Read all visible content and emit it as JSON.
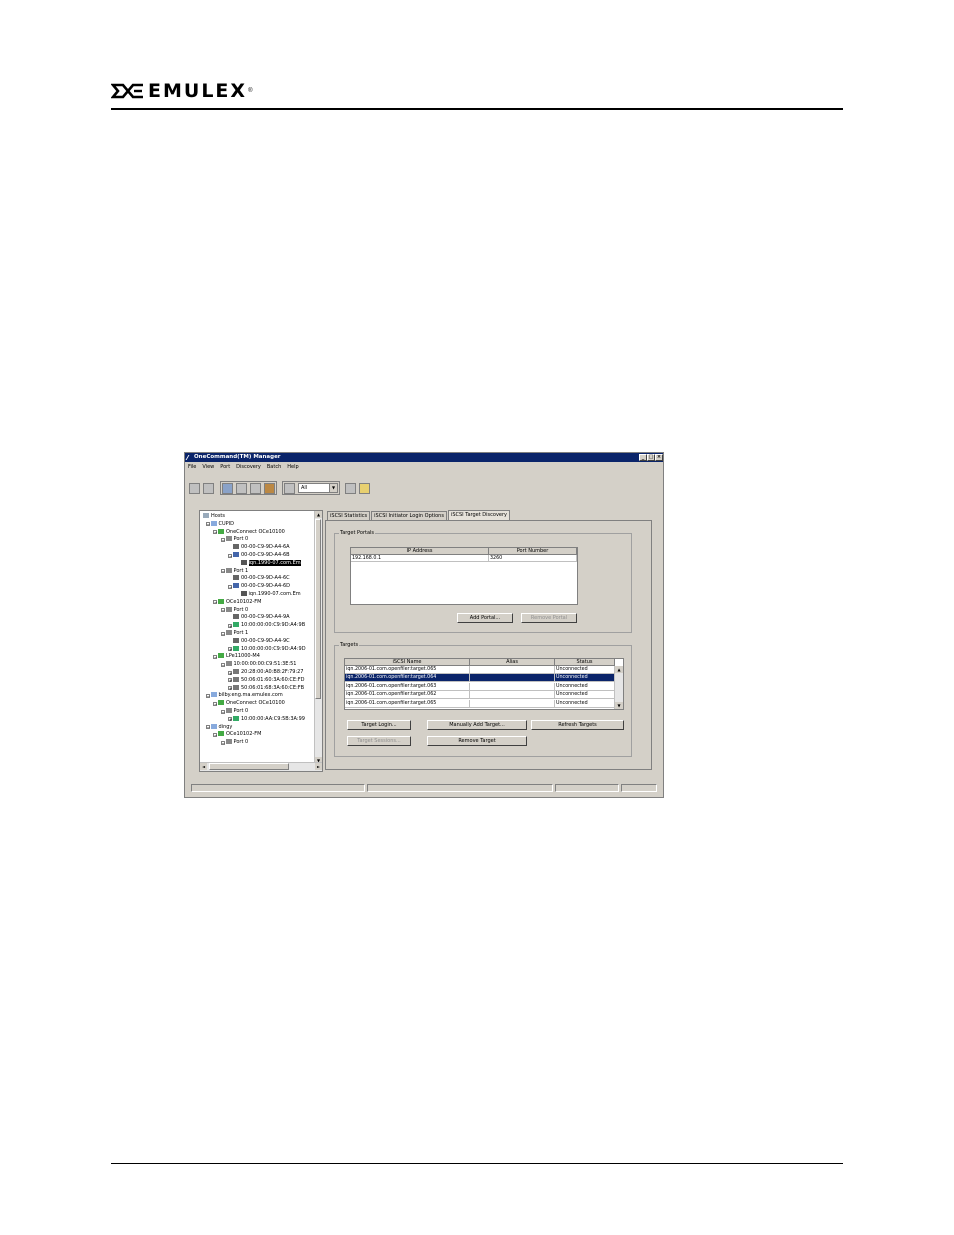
{
  "brand": {
    "name": "EMULEX",
    "mark": "®",
    "logo_icon": "emulex-x-logo-icon"
  },
  "window": {
    "title": "OneCommand(TM) Manager",
    "controls": [
      "_",
      "□",
      "×"
    ],
    "menu": [
      "File",
      "View",
      "Port",
      "Discovery",
      "Batch",
      "Help"
    ],
    "toolbar_combo": "All"
  },
  "tree": [
    {
      "label": "Hosts",
      "depth": 0,
      "exp": "",
      "icon": "hosts-icon"
    },
    {
      "label": "CUPID",
      "depth": 1,
      "exp": "−",
      "icon": "host-icon"
    },
    {
      "label": "OneConnect OCe10100",
      "depth": 2,
      "exp": "−",
      "icon": "adapter-icon"
    },
    {
      "label": "Port 0",
      "depth": 3,
      "exp": "−",
      "icon": "port-icon"
    },
    {
      "label": "00-00-C9-9D-A4-6A",
      "depth": 4,
      "exp": "",
      "icon": "nic-icon"
    },
    {
      "label": "00-00-C9-9D-A4-6B",
      "depth": 4,
      "exp": "−",
      "icon": "iscsi-icon"
    },
    {
      "label": "iqn.1990-07.com.Em",
      "depth": 5,
      "exp": "",
      "icon": "target-icon",
      "hl": true
    },
    {
      "label": "Port 1",
      "depth": 3,
      "exp": "−",
      "icon": "port-icon"
    },
    {
      "label": "00-00-C9-9D-A4-6C",
      "depth": 4,
      "exp": "",
      "icon": "nic-icon"
    },
    {
      "label": "00-00-C9-9D-A4-6D",
      "depth": 4,
      "exp": "−",
      "icon": "iscsi-icon"
    },
    {
      "label": "iqn.1990-07.com.Em",
      "depth": 5,
      "exp": "",
      "icon": "target-icon"
    },
    {
      "label": "OCe10102-FM",
      "depth": 2,
      "exp": "−",
      "icon": "adapter-icon"
    },
    {
      "label": "Port 0",
      "depth": 3,
      "exp": "−",
      "icon": "port-icon"
    },
    {
      "label": "00-00-C9-9D-A4-9A",
      "depth": 4,
      "exp": "",
      "icon": "nic-icon"
    },
    {
      "label": "10:00:00:00:C9:9D:A4:9B",
      "depth": 4,
      "exp": "+",
      "icon": "fcoe-icon"
    },
    {
      "label": "Port 1",
      "depth": 3,
      "exp": "−",
      "icon": "port-icon"
    },
    {
      "label": "00-00-C9-9D-A4-9C",
      "depth": 4,
      "exp": "",
      "icon": "nic-icon"
    },
    {
      "label": "10:00:00:00:C9:9D:A4:9D",
      "depth": 4,
      "exp": "+",
      "icon": "fcoe-icon"
    },
    {
      "label": "LPe11000-M4",
      "depth": 2,
      "exp": "−",
      "icon": "adapter-icon"
    },
    {
      "label": "10:00:00:00:C9:51:3E:51",
      "depth": 3,
      "exp": "−",
      "icon": "port-icon"
    },
    {
      "label": "20:28:00:A0:B8:2F:79:27",
      "depth": 4,
      "exp": "+",
      "icon": "lun-icon"
    },
    {
      "label": "50:06:01:60:3A:60:CE:FD",
      "depth": 4,
      "exp": "+",
      "icon": "lun-icon"
    },
    {
      "label": "50:06:01:68:3A:60:CE:FB",
      "depth": 4,
      "exp": "+",
      "icon": "lun-icon"
    },
    {
      "label": "bilby.eng.ma.emulex.com",
      "depth": 1,
      "exp": "−",
      "icon": "host-icon"
    },
    {
      "label": "OneConnect OCe10100",
      "depth": 2,
      "exp": "−",
      "icon": "adapter-icon"
    },
    {
      "label": "Port 0",
      "depth": 3,
      "exp": "−",
      "icon": "port-icon"
    },
    {
      "label": "10:00:00:AA:C9:5B:3A:99",
      "depth": 4,
      "exp": "+",
      "icon": "fcoe-icon"
    },
    {
      "label": "dingy",
      "depth": 1,
      "exp": "−",
      "icon": "host-icon"
    },
    {
      "label": "OCe10102-FM",
      "depth": 2,
      "exp": "−",
      "icon": "adapter-icon"
    },
    {
      "label": "Port 0",
      "depth": 3,
      "exp": "−",
      "icon": "port-icon"
    }
  ],
  "tabs": [
    "iSCSI Statistics",
    "iSCSI Initiator Login Options",
    "iSCSI Target Discovery"
  ],
  "target_portals": {
    "label": "Target Portals",
    "columns": [
      "IP Address",
      "Port Number"
    ],
    "rows": [
      [
        "192.168.0.1",
        "3260"
      ]
    ],
    "add_button": "Add Portal...",
    "remove_button": "Remove Portal"
  },
  "targets": {
    "label": "Targets",
    "columns": [
      "iSCSI Name",
      "Alias",
      "Status"
    ],
    "rows": [
      [
        "iqn.2006-01.com.openfiler:target.065",
        "",
        "Unconnected"
      ],
      [
        "iqn.2006-01.com.openfiler:target.064",
        "",
        "Unconnected"
      ],
      [
        "iqn.2006-01.com.openfiler:target.063",
        "",
        "Unconnected"
      ],
      [
        "iqn.2006-01.com.openfiler:target.062",
        "",
        "Unconnected"
      ],
      [
        "iqn.2006-01.com.openfiler:target.065",
        "",
        "Unconnected"
      ]
    ],
    "selected_index": 1,
    "buttons": {
      "login": "Target Login...",
      "manual_add": "Manually Add Target...",
      "refresh": "Refresh Targets",
      "sessions": "Target Sessions...",
      "remove": "Remove Target"
    }
  }
}
